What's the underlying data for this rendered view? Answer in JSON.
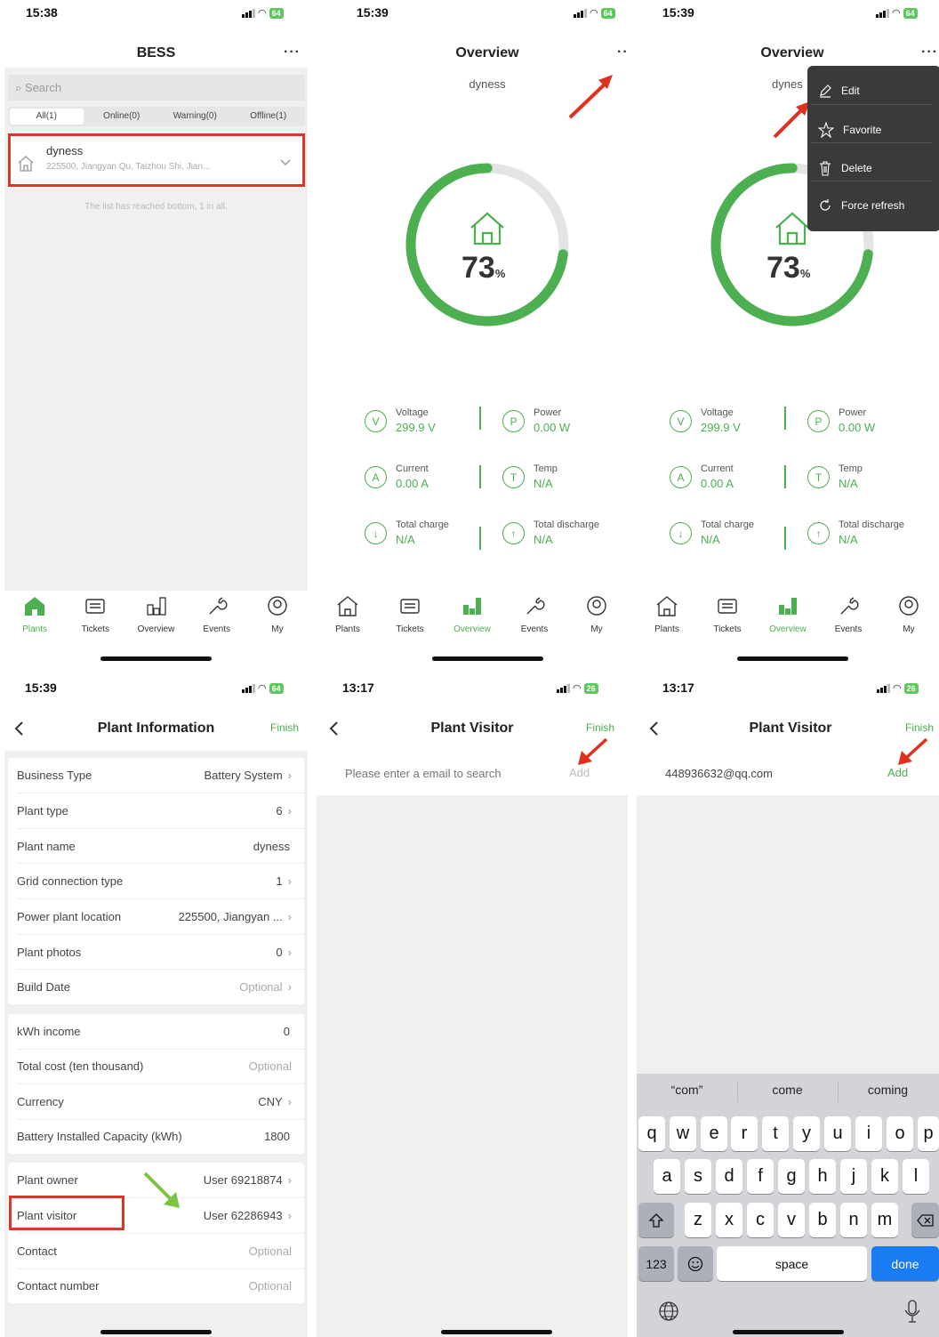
{
  "screens": {
    "plants_list": {
      "status": {
        "time": "15:38",
        "battery": "64"
      },
      "title": "BESS",
      "more": "···",
      "search_placeholder": "Search",
      "filters": [
        "All(1)",
        "Online(0)",
        "Warning(0)",
        "Offline(1)"
      ],
      "plant": {
        "name": "dyness",
        "address": "225500, Jiangyan Qu, Taizhou Shi, Jian..."
      },
      "list_end": "The list has reached bottom, 1 in all."
    },
    "overview": {
      "status": {
        "time": "15:39",
        "battery": "64"
      },
      "title": "Overview",
      "more": "···",
      "plant_name": "dyness",
      "soc_value": "73",
      "soc_unit": "%",
      "soc_fraction": 0.73,
      "metrics": [
        {
          "icon": "V",
          "label": "Voltage",
          "value": "299.9  V"
        },
        {
          "icon": "P",
          "label": "Power",
          "value": "0.00  W"
        },
        {
          "icon": "A",
          "label": "Current",
          "value": "0.00  A"
        },
        {
          "icon": "T",
          "label": "Temp",
          "value": "N/A"
        },
        {
          "icon": "charge",
          "label": "Total charge",
          "value": "N/A"
        },
        {
          "icon": "discharge",
          "label": "Total discharge",
          "value": "N/A"
        }
      ]
    },
    "overview_menu": {
      "status": {
        "time": "15:39",
        "battery": "64"
      },
      "title": "Overview",
      "plant_name_partial": "dynes",
      "menu": [
        "Edit",
        "Favorite",
        "Delete",
        "Force refresh"
      ]
    },
    "plant_info": {
      "status": {
        "time": "15:39",
        "battery": "64"
      },
      "title": "Plant Information",
      "finish": "Finish",
      "group1": [
        {
          "label": "Business Type",
          "value": "Battery System",
          "chevron": true
        },
        {
          "label": "Plant type",
          "value": "6",
          "chevron": true
        },
        {
          "label": "Plant name",
          "value": "dyness",
          "chevron": false
        },
        {
          "label": "Grid connection type",
          "value": "1",
          "chevron": true
        },
        {
          "label": "Power plant location",
          "value": "225500, Jiangyan ...",
          "chevron": true
        },
        {
          "label": "Plant photos",
          "value": "0",
          "chevron": true
        },
        {
          "label": "Build Date",
          "value": "Optional",
          "chevron": true,
          "optional": true
        }
      ],
      "group2": [
        {
          "label": "kWh income",
          "value": "0",
          "chevron": false
        },
        {
          "label": "Total cost (ten thousand)",
          "value": "Optional",
          "chevron": false,
          "optional": true
        },
        {
          "label": "Currency",
          "value": "CNY",
          "chevron": true
        },
        {
          "label": "Battery Installed Capacity  (kWh)",
          "value": "1800",
          "chevron": false
        }
      ],
      "group3": [
        {
          "label": "Plant owner",
          "value": "User 69218874",
          "chevron": true
        },
        {
          "label": "Plant visitor",
          "value": "User 62286943",
          "chevron": true
        },
        {
          "label": "Contact",
          "value": "Optional",
          "chevron": false,
          "optional": true
        },
        {
          "label": "Contact number",
          "value": "Optional",
          "chevron": false,
          "optional": true
        }
      ]
    },
    "visitor_empty": {
      "status": {
        "time": "13:17",
        "battery": "26"
      },
      "title": "Plant Visitor",
      "finish": "Finish",
      "placeholder": "Please enter a email to search",
      "add": "Add"
    },
    "visitor_filled": {
      "status": {
        "time": "13:17",
        "battery": "26"
      },
      "title": "Plant Visitor",
      "finish": "Finish",
      "email_value": "448936632@qq.com",
      "add": "Add",
      "suggestions": [
        "“com”",
        "come",
        "coming"
      ],
      "keyboard": {
        "row1": [
          "q",
          "w",
          "e",
          "r",
          "t",
          "y",
          "u",
          "i",
          "o",
          "p"
        ],
        "row2": [
          "a",
          "s",
          "d",
          "f",
          "g",
          "h",
          "j",
          "k",
          "l"
        ],
        "row3": [
          "z",
          "x",
          "c",
          "v",
          "b",
          "n",
          "m"
        ],
        "numbers": "123",
        "space": "space",
        "done": "done"
      }
    }
  },
  "tabs": [
    "Plants",
    "Tickets",
    "Overview",
    "Events",
    "My"
  ],
  "colors": {
    "accent": "#4caf50",
    "highlight_red": "#d9372a",
    "arrow_green": "#7dc242",
    "menu_bg": "#3a3a3a",
    "keyboard_bg": "#d2d4da",
    "done_blue": "#1a7cf5"
  }
}
